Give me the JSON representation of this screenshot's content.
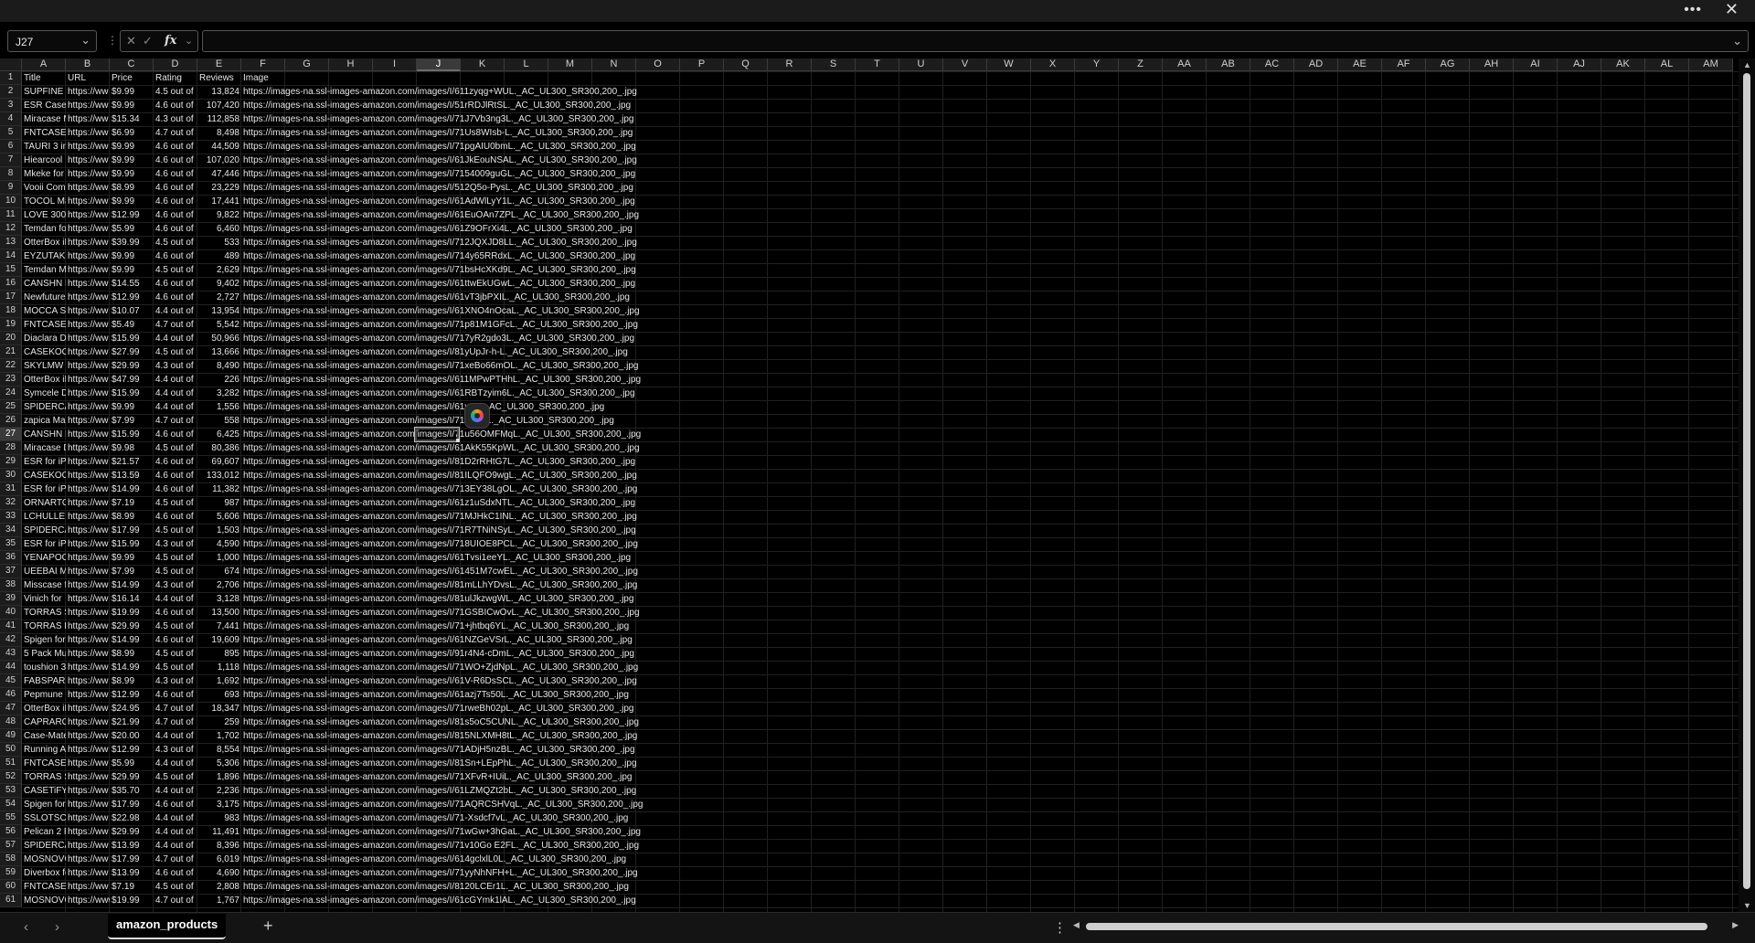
{
  "window": {
    "more_icon": "ellipsis-icon",
    "close_icon": "close-icon"
  },
  "formula_bar": {
    "name_box": "J27",
    "formula": "",
    "fx_label": "fx"
  },
  "columns": [
    "A",
    "B",
    "C",
    "D",
    "E",
    "F",
    "G",
    "H",
    "I",
    "J",
    "K",
    "L",
    "M",
    "N",
    "O",
    "P",
    "Q",
    "R",
    "S",
    "T",
    "U",
    "V",
    "W",
    "X",
    "Y",
    "Z",
    "AA",
    "AB",
    "AC",
    "AD",
    "AE",
    "AF",
    "AG",
    "AH",
    "AI",
    "AJ",
    "AK",
    "AL",
    "AM"
  ],
  "selected_cell": {
    "column": "J",
    "row": 27
  },
  "headers": [
    "Title",
    "URL",
    "Price",
    "Rating",
    "Reviews",
    "Image"
  ],
  "rows": [
    [
      "SUPFINE M",
      "https://ww",
      "$9.99",
      "4.5 out of",
      "13,824",
      "https://images-na.ssl-images-amazon.com/images/I/611zyqg+WUL._AC_UL300_SR300,200_.jpg"
    ],
    [
      "ESR Case",
      "https://ww",
      "$9.99",
      "4.6 out of",
      "107,420",
      "https://images-na.ssl-images-amazon.com/images/I/51rRDJlRtSL._AC_UL300_SR300,200_.jpg"
    ],
    [
      "Miracase M",
      "https://ww",
      "$15.34",
      "4.3 out of",
      "112,858",
      "https://images-na.ssl-images-amazon.com/images/I/71J7Vb3ng3L._AC_UL300_SR300,200_.jpg"
    ],
    [
      "FNTCASE",
      "https://ww",
      "$6.99",
      "4.7 out of",
      "8,498",
      "https://images-na.ssl-images-amazon.com/images/I/71Us8WIsb-L._AC_UL300_SR300,200_.jpg"
    ],
    [
      "TAURI 3 in",
      "https://ww",
      "$9.99",
      "4.6 out of",
      "44,509",
      "https://images-na.ssl-images-amazon.com/images/I/71pgAIU0bmL._AC_UL300_SR300,200_.jpg"
    ],
    [
      "Hiearcool",
      "https://ww",
      "$9.99",
      "4.6 out of",
      "107,020",
      "https://images-na.ssl-images-amazon.com/images/I/61JkEouNSAL._AC_UL300_SR300,200_.jpg"
    ],
    [
      "Mkeke for",
      "https://ww",
      "$9.99",
      "4.6 out of",
      "47,446",
      "https://images-na.ssl-images-amazon.com/images/I/7154009guGL._AC_UL300_SR300,200_.jpg"
    ],
    [
      "Vooii Com",
      "https://ww",
      "$8.99",
      "4.6 out of",
      "23,229",
      "https://images-na.ssl-images-amazon.com/images/I/512Q5o-PysL._AC_UL300_SR300,200_.jpg"
    ],
    [
      "TOCOL Ma",
      "https://ww",
      "$9.99",
      "4.6 out of",
      "17,441",
      "https://images-na.ssl-images-amazon.com/images/I/61AdWlLyY1L._AC_UL300_SR300,200_.jpg"
    ],
    [
      "LOVE 300",
      "https://ww",
      "$12.99",
      "4.6 out of",
      "9,822",
      "https://images-na.ssl-images-amazon.com/images/I/61EuOAn7ZPL._AC_UL300_SR300,200_.jpg"
    ],
    [
      "Temdan fo",
      "https://ww",
      "$5.99",
      "4.6 out of",
      "6,460",
      "https://images-na.ssl-images-amazon.com/images/I/61Z9OFrXi4L._AC_UL300_SR300,200_.jpg"
    ],
    [
      "OtterBox iF",
      "https://ww",
      "$39.99",
      "4.5 out of",
      "533",
      "https://images-na.ssl-images-amazon.com/images/I/712JQXJD8LL._AC_UL300_SR300,200_.jpg"
    ],
    [
      "EYZUTAK",
      "https://ww",
      "$9.99",
      "4.6 out of",
      "489",
      "https://images-na.ssl-images-amazon.com/images/I/714y65RRdxL._AC_UL300_SR300,200_.jpg"
    ],
    [
      "Temdan M",
      "https://ww",
      "$9.99",
      "4.5 out of",
      "2,629",
      "https://images-na.ssl-images-amazon.com/images/I/71bsHcXKd9L._AC_UL300_SR300,200_.jpg"
    ],
    [
      "CANSHN M",
      "https://ww",
      "$14.55",
      "4.6 out of",
      "9,402",
      "https://images-na.ssl-images-amazon.com/images/I/61ttwEkUGwL._AC_UL300_SR300,200_.jpg"
    ],
    [
      "Newfuture",
      "https://ww",
      "$12.99",
      "4.6 out of",
      "2,727",
      "https://images-na.ssl-images-amazon.com/images/I/61vT3jbPXIL._AC_UL300_SR300,200_.jpg"
    ],
    [
      "MOCCA SI",
      "https://ww",
      "$10.07",
      "4.4 out of",
      "13,954",
      "https://images-na.ssl-images-amazon.com/images/I/61XNO4nOcaL._AC_UL300_SR300,200_.jpg"
    ],
    [
      "FNTCASE",
      "https://ww",
      "$5.49",
      "4.7 out of",
      "5,542",
      "https://images-na.ssl-images-amazon.com/images/I/71p81M1GFcL._AC_UL300_SR300,200_.jpg"
    ],
    [
      "Diaclara D",
      "https://ww",
      "$15.99",
      "4.4 out of",
      "50,966",
      "https://images-na.ssl-images-amazon.com/images/I/717yR2gdo3L._AC_UL300_SR300,200_.jpg"
    ],
    [
      "CASEKOO",
      "https://ww",
      "$27.99",
      "4.5 out of",
      "13,666",
      "https://images-na.ssl-images-amazon.com/images/I/81yUpJr-h-L._AC_UL300_SR300,200_.jpg"
    ],
    [
      "SKYLMW C",
      "https://ww",
      "$29.99",
      "4.3 out of",
      "8,490",
      "https://images-na.ssl-images-amazon.com/images/I/71xeBo66mOL._AC_UL300_SR300,200_.jpg"
    ],
    [
      "OtterBox iF",
      "https://ww",
      "$47.99",
      "4.4 out of",
      "226",
      "https://images-na.ssl-images-amazon.com/images/I/611MPwPTHhL._AC_UL300_SR300,200_.jpg"
    ],
    [
      "Symcele D",
      "https://ww",
      "$15.99",
      "4.4 out of",
      "3,282",
      "https://images-na.ssl-images-amazon.com/images/I/61RBTzyim6L._AC_UL300_SR300,200_.jpg"
    ],
    [
      "SPIDERCA",
      "https://ww",
      "$9.99",
      "4.4 out of",
      "1,556",
      "https://images-na.ssl-images-amazon.com/images/I/61yQL._AC_UL300_SR300,200_.jpg"
    ],
    [
      "zapica Mag",
      "https://ww",
      "$7.99",
      "4.7 out of",
      "558",
      "https://images-na.ssl-images-amazon.com/images/I/71Q1-VL._AC_UL300_SR300,200_.jpg"
    ],
    [
      "CANSHN M",
      "https://ww",
      "$15.99",
      "4.6 out of",
      "6,425",
      "https://images-na.ssl-images-amazon.com/images/I/71u56OMFMqL._AC_UL300_SR300,200_.jpg"
    ],
    [
      "Miracase D",
      "https://ww",
      "$9.98",
      "4.5 out of",
      "80,386",
      "https://images-na.ssl-images-amazon.com/images/I/61AkK55KpWL._AC_UL300_SR300,200_.jpg"
    ],
    [
      "ESR for iPh",
      "https://ww",
      "$21.57",
      "4.6 out of",
      "69,607",
      "https://images-na.ssl-images-amazon.com/images/I/81D2rRHtG7L._AC_UL300_SR300,200_.jpg"
    ],
    [
      "CASEKOO",
      "https://ww",
      "$13.59",
      "4.6 out of",
      "133,012",
      "https://images-na.ssl-images-amazon.com/images/I/81ILQFO9wgL._AC_UL300_SR300,200_.jpg"
    ],
    [
      "ESR for iPh",
      "https://ww",
      "$14.99",
      "4.6 out of",
      "11,382",
      "https://images-na.ssl-images-amazon.com/images/I/713EY38LgOL._AC_UL300_SR300,200_.jpg"
    ],
    [
      "ORNARTO",
      "https://ww",
      "$7.19",
      "4.5 out of",
      "987",
      "https://images-na.ssl-images-amazon.com/images/I/61z1uSdxNTL._AC_UL300_SR300,200_.jpg"
    ],
    [
      "LCHULLE",
      "https://ww",
      "$8.99",
      "4.6 out of",
      "5,606",
      "https://images-na.ssl-images-amazon.com/images/I/71MJHkC1INL._AC_UL300_SR300,200_.jpg"
    ],
    [
      "SPIDERCA",
      "https://ww",
      "$17.99",
      "4.5 out of",
      "1,503",
      "https://images-na.ssl-images-amazon.com/images/I/71R7TNiNSyL._AC_UL300_SR300,200_.jpg"
    ],
    [
      "ESR for iPh",
      "https://ww",
      "$15.99",
      "4.3 out of",
      "4,590",
      "https://images-na.ssl-images-amazon.com/images/I/718UIOE8PCL._AC_UL300_SR300,200_.jpg"
    ],
    [
      "YENAPOO",
      "https://ww",
      "$9.99",
      "4.5 out of",
      "1,000",
      "https://images-na.ssl-images-amazon.com/images/I/61Tvsi1eeYL._AC_UL300_SR300,200_.jpg"
    ],
    [
      "UEEBAI M",
      "https://ww",
      "$7.99",
      "4.5 out of",
      "674",
      "https://images-na.ssl-images-amazon.com/images/I/61451M7cwEL._AC_UL300_SR300,200_.jpg"
    ],
    [
      "Misscase f",
      "https://ww",
      "$14.99",
      "4.3 out of",
      "2,706",
      "https://images-na.ssl-images-amazon.com/images/I/81mLLhYDvsL._AC_UL300_SR300,200_.jpg"
    ],
    [
      "Vinich for",
      "https://ww",
      "$16.14",
      "4.4 out of",
      "3,128",
      "https://images-na.ssl-images-amazon.com/images/I/81ulJkzwgWL._AC_UL300_SR300,200_.jpg"
    ],
    [
      "TORRAS S",
      "https://ww",
      "$19.99",
      "4.6 out of",
      "13,500",
      "https://images-na.ssl-images-amazon.com/images/I/71GSBICwOvL._AC_UL300_SR300,200_.jpg"
    ],
    [
      "TORRAS D",
      "https://ww",
      "$29.99",
      "4.5 out of",
      "7,441",
      "https://images-na.ssl-images-amazon.com/images/I/71+jhtbq6YL._AC_UL300_SR300,200_.jpg"
    ],
    [
      "Spigen for",
      "https://ww",
      "$14.99",
      "4.6 out of",
      "19,609",
      "https://images-na.ssl-images-amazon.com/images/I/61NZGeVSrL._AC_UL300_SR300,200_.jpg"
    ],
    [
      "5 Pack Mu",
      "https://ww",
      "$8.99",
      "4.5 out of",
      "895",
      "https://images-na.ssl-images-amazon.com/images/I/91r4N4-cDmL._AC_UL300_SR300,200_.jpg"
    ],
    [
      "toushion 3",
      "https://ww",
      "$14.99",
      "4.5 out of",
      "1,118",
      "https://images-na.ssl-images-amazon.com/images/I/71WO+ZjdNpL._AC_UL300_SR300,200_.jpg"
    ],
    [
      "FABSPARK",
      "https://ww",
      "$8.99",
      "4.3 out of",
      "1,692",
      "https://images-na.ssl-images-amazon.com/images/I/61V-R6DsSCL._AC_UL300_SR300,200_.jpg"
    ],
    [
      "Pepmune",
      "https://ww",
      "$12.99",
      "4.6 out of",
      "693",
      "https://images-na.ssl-images-amazon.com/images/I/61azj7Ts50L._AC_UL300_SR300,200_.jpg"
    ],
    [
      "OtterBox iF",
      "https://ww",
      "$24.95",
      "4.7 out of",
      "18,347",
      "https://images-na.ssl-images-amazon.com/images/I/71rweBh02pL._AC_UL300_SR300,200_.jpg"
    ],
    [
      "CAPRARO",
      "https://ww",
      "$21.99",
      "4.7 out of",
      "259",
      "https://images-na.ssl-images-amazon.com/images/I/81s5oC5CUNL._AC_UL300_SR300,200_.jpg"
    ],
    [
      "Case-Mate",
      "https://ww",
      "$20.00",
      "4.4 out of",
      "1,702",
      "https://images-na.ssl-images-amazon.com/images/I/815NLXMH8tL._AC_UL300_SR300,200_.jpg"
    ],
    [
      "Running A",
      "https://ww",
      "$12.99",
      "4.3 out of",
      "8,554",
      "https://images-na.ssl-images-amazon.com/images/I/71ADjH5nzBL._AC_UL300_SR300,200_.jpg"
    ],
    [
      "FNTCASE",
      "https://ww",
      "$5.99",
      "4.4 out of",
      "5,306",
      "https://images-na.ssl-images-amazon.com/images/I/81Sn+LEpPhL._AC_UL300_SR300,200_.jpg"
    ],
    [
      "TORRAS S",
      "https://ww",
      "$29.99",
      "4.5 out of",
      "1,896",
      "https://images-na.ssl-images-amazon.com/images/I/71XFvR+IUiL._AC_UL300_SR300,200_.jpg"
    ],
    [
      "CASETiFY",
      "https://ww",
      "$35.70",
      "4.4 out of",
      "2,236",
      "https://images-na.ssl-images-amazon.com/images/I/61LZMQZt2bL._AC_UL300_SR300,200_.jpg"
    ],
    [
      "Spigen for",
      "https://ww",
      "$17.99",
      "4.6 out of",
      "3,175",
      "https://images-na.ssl-images-amazon.com/images/I/71AQRCSHVqL._AC_UL300_SR300,200_.jpg"
    ],
    [
      "SSLOTSC/",
      "https://ww",
      "$22.98",
      "4.4 out of",
      "983",
      "https://images-na.ssl-images-amazon.com/images/I/71-Xsdcf7vL._AC_UL300_SR300,200_.jpg"
    ],
    [
      "Pelican 2 F",
      "https://ww",
      "$29.99",
      "4.4 out of",
      "11,491",
      "https://images-na.ssl-images-amazon.com/images/I/71wGw+3hGaL._AC_UL300_SR300,200_.jpg"
    ],
    [
      "SPIDERCA",
      "https://ww",
      "$13.99",
      "4.4 out of",
      "8,396",
      "https://images-na.ssl-images-amazon.com/images/I/71v10Go E2FL._AC_UL300_SR300,200_.jpg"
    ],
    [
      "MOSNOVO",
      "https://ww",
      "$17.99",
      "4.7 out of",
      "6,019",
      "https://images-na.ssl-images-amazon.com/images/I/614gclxlL0L._AC_UL300_SR300,200_.jpg"
    ],
    [
      "Diverbox fo",
      "https://ww",
      "$13.99",
      "4.6 out of",
      "4,690",
      "https://images-na.ssl-images-amazon.com/images/I/71yyNhNFH+L._AC_UL300_SR300,200_.jpg"
    ],
    [
      "FNTCASE",
      "https://ww",
      "$7.19",
      "4.5 out of",
      "2,808",
      "https://images-na.ssl-images-amazon.com/images/I/8120LCEr1L._AC_UL300_SR300,200_.jpg"
    ],
    [
      "MOSNOVO",
      "https://www.amazon.",
      "$19.99",
      "4.7 out of",
      "1,767",
      "https://images-na.ssl-images-amazon.com/images/I/61cGYmk1lAL._AC_UL300_SR300,200_.jpg"
    ]
  ],
  "sheet_tabs": [
    {
      "label": "amazon_products",
      "active": true
    }
  ],
  "bottom": {
    "add_sheet": "+",
    "prev": "‹",
    "next": "›",
    "more": "⋮"
  }
}
